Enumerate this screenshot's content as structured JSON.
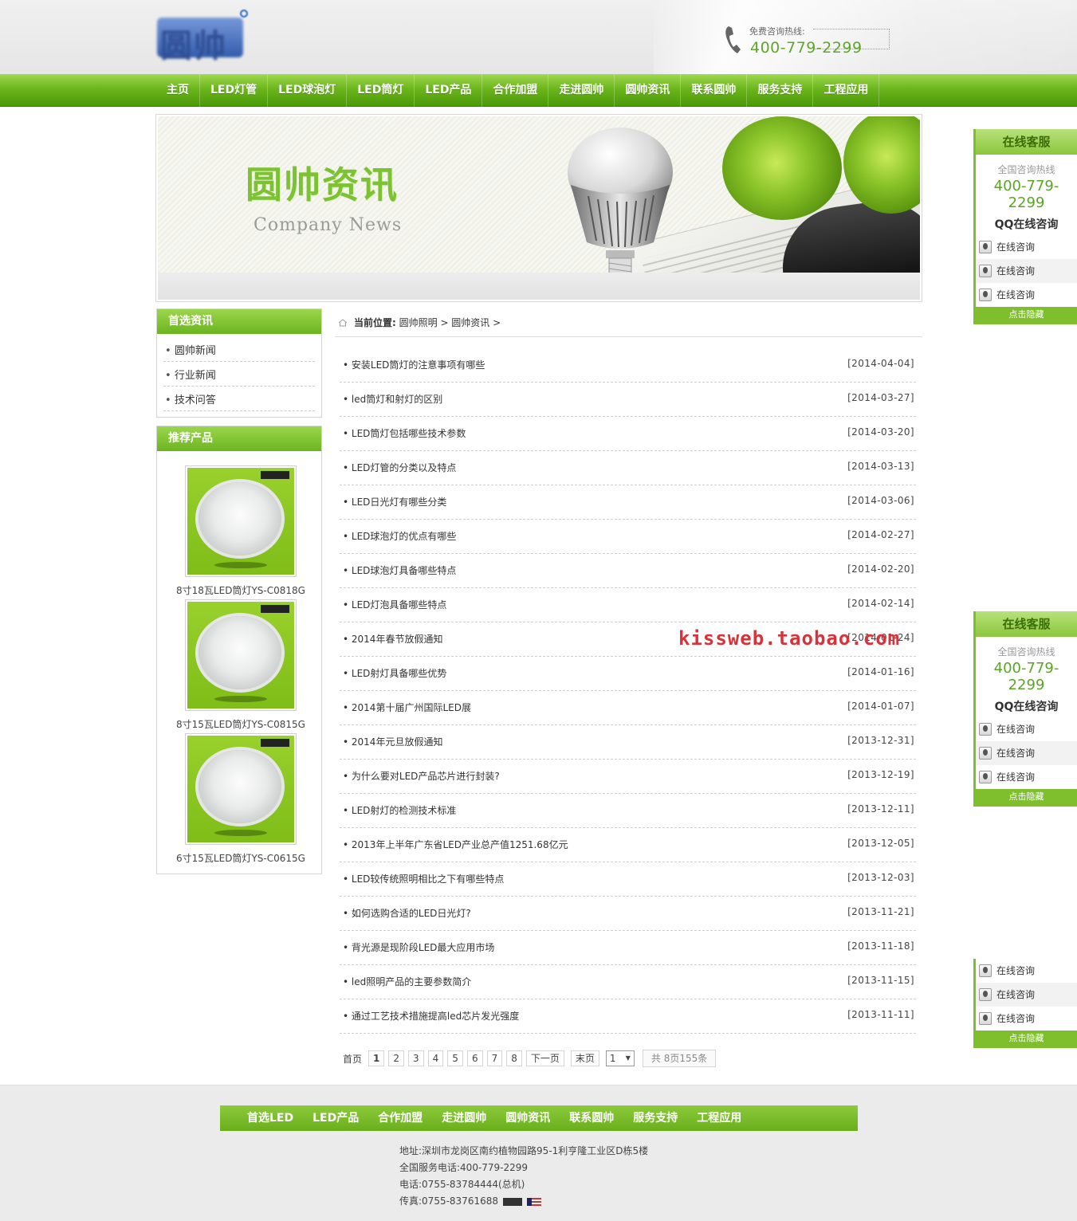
{
  "header": {
    "logo_text": "圆帅",
    "slogan_line1": "",
    "slogan_line2": "",
    "hotline_label": "免费咨询热线:",
    "hotline_number": "400-779-2299"
  },
  "nav": {
    "items": [
      "主页",
      "LED灯管",
      "LED球泡灯",
      "LED筒灯",
      "LED产品",
      "合作加盟",
      "走进圆帅",
      "圆帅资讯",
      "联系圆帅",
      "服务支持",
      "工程应用"
    ]
  },
  "banner": {
    "title": "圆帅资讯",
    "subtitle": "Company News"
  },
  "sidebar": {
    "news_title": "首选资讯",
    "news_items": [
      "圆帅新闻",
      "行业新闻",
      "技术问答"
    ],
    "products_title": "推荐产品",
    "products": [
      {
        "name": "8寸18瓦LED筒灯YS-C0818G"
      },
      {
        "name": "8寸15瓦LED筒灯YS-C0815G"
      },
      {
        "name": "6寸15瓦LED筒灯YS-C0615G"
      }
    ]
  },
  "breadcrumb": {
    "label": "当前位置:",
    "path": " 圆帅照明 > 圆帅资讯 >"
  },
  "news": [
    {
      "title": "安装LED筒灯的注意事项有哪些",
      "date": "[2014-04-04]"
    },
    {
      "title": "led筒灯和射灯的区别",
      "date": "[2014-03-27]"
    },
    {
      "title": "LED筒灯包括哪些技术参数",
      "date": "[2014-03-20]"
    },
    {
      "title": "LED灯管的分类以及特点",
      "date": "[2014-03-13]"
    },
    {
      "title": "LED日光灯有哪些分类",
      "date": "[2014-03-06]"
    },
    {
      "title": "LED球泡灯的优点有哪些",
      "date": "[2014-02-27]"
    },
    {
      "title": "LED球泡灯具备哪些特点",
      "date": "[2014-02-20]"
    },
    {
      "title": "LED灯泡具备哪些特点",
      "date": "[2014-02-14]"
    },
    {
      "title": "2014年春节放假通知",
      "date": "[2014-01-24]"
    },
    {
      "title": "LED射灯具备哪些优势",
      "date": "[2014-01-16]"
    },
    {
      "title": "2014第十届广州国际LED展",
      "date": "[2014-01-07]"
    },
    {
      "title": "2014年元旦放假通知",
      "date": "[2013-12-31]"
    },
    {
      "title": "为什么要对LED产品芯片进行封装?",
      "date": "[2013-12-19]"
    },
    {
      "title": "LED射灯的检测技术标准",
      "date": "[2013-12-11]"
    },
    {
      "title": "2013年上半年广东省LED产业总产值1251.68亿元",
      "date": "[2013-12-05]"
    },
    {
      "title": "LED较传统照明相比之下有哪些特点",
      "date": "[2013-12-03]"
    },
    {
      "title": "如何选购合适的LED日光灯?",
      "date": "[2013-11-21]"
    },
    {
      "title": "背光源是现阶段LED最大应用市场",
      "date": "[2013-11-18]"
    },
    {
      "title": "led照明产品的主要参数简介",
      "date": "[2013-11-15]"
    },
    {
      "title": "通过工艺技术措施提高led芯片发光强度",
      "date": "[2013-11-11]"
    }
  ],
  "watermark": "kissweb.taobao.com",
  "pager": {
    "first": "首页",
    "pages": [
      "1",
      "2",
      "3",
      "4",
      "5",
      "6",
      "7",
      "8"
    ],
    "current": "1",
    "next": "下一页",
    "last": "末页",
    "select_value": "1",
    "total": "共 8页155条"
  },
  "service": {
    "title": "在线客服",
    "hotline_label": "全国咨询热线",
    "hotline_number": "400-779-2299",
    "qq_title": "QQ在线咨询",
    "consult_label": "在线咨询",
    "hide_label": "点击隐藏"
  },
  "footer": {
    "nav": [
      "首选LED",
      "LED产品",
      "合作加盟",
      "走进圆帅",
      "圆帅资讯",
      "联系圆帅",
      "服务支持",
      "工程应用"
    ],
    "address": "地址:深圳市龙岗区南约植物园路95-1利亨隆工业区D栋5楼",
    "service_phone": "全国服务电话:400-779-2299",
    "phone": "电话:0755-83784444(总机)",
    "fax": "传真:0755-83761688",
    "cnzz": "CNZZ"
  },
  "colors": {
    "brand_green": "#6cb420",
    "number_green": "#5ea72a",
    "watermark_red": "#d8333a"
  }
}
